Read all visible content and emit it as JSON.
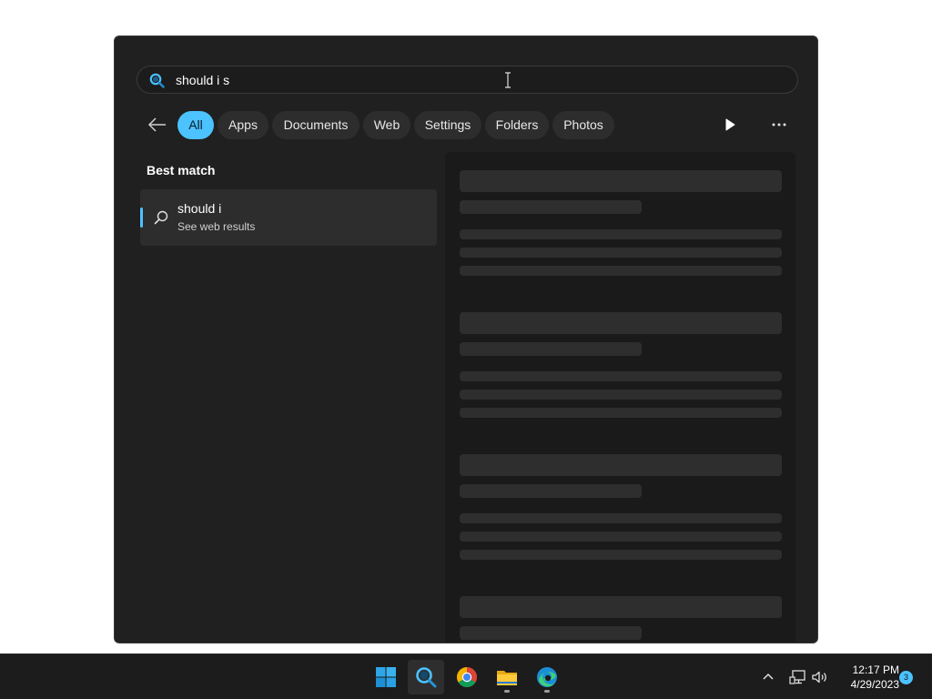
{
  "search": {
    "query": "should i s"
  },
  "filters": {
    "chips": [
      {
        "label": "All"
      },
      {
        "label": "Apps"
      },
      {
        "label": "Documents"
      },
      {
        "label": "Web"
      },
      {
        "label": "Settings"
      },
      {
        "label": "Folders"
      },
      {
        "label": "Photos"
      }
    ],
    "active_index": 0
  },
  "results": {
    "section_title": "Best match",
    "best_match": {
      "title": "should i",
      "subtitle": "See web results"
    }
  },
  "preview": {
    "state": "loading"
  },
  "taskbar": {
    "apps": [
      {
        "icon": "windows-start-icon"
      },
      {
        "icon": "search-icon"
      },
      {
        "icon": "chrome-icon"
      },
      {
        "icon": "file-explorer-icon"
      },
      {
        "icon": "edge-icon"
      }
    ],
    "clock_time": "12:17 PM",
    "clock_date": "4/29/2023",
    "notification_count": "3"
  },
  "colors": {
    "accent": "#4cc2ff",
    "panel_bg": "#202020",
    "taskbar_bg": "#1c1c1c"
  }
}
